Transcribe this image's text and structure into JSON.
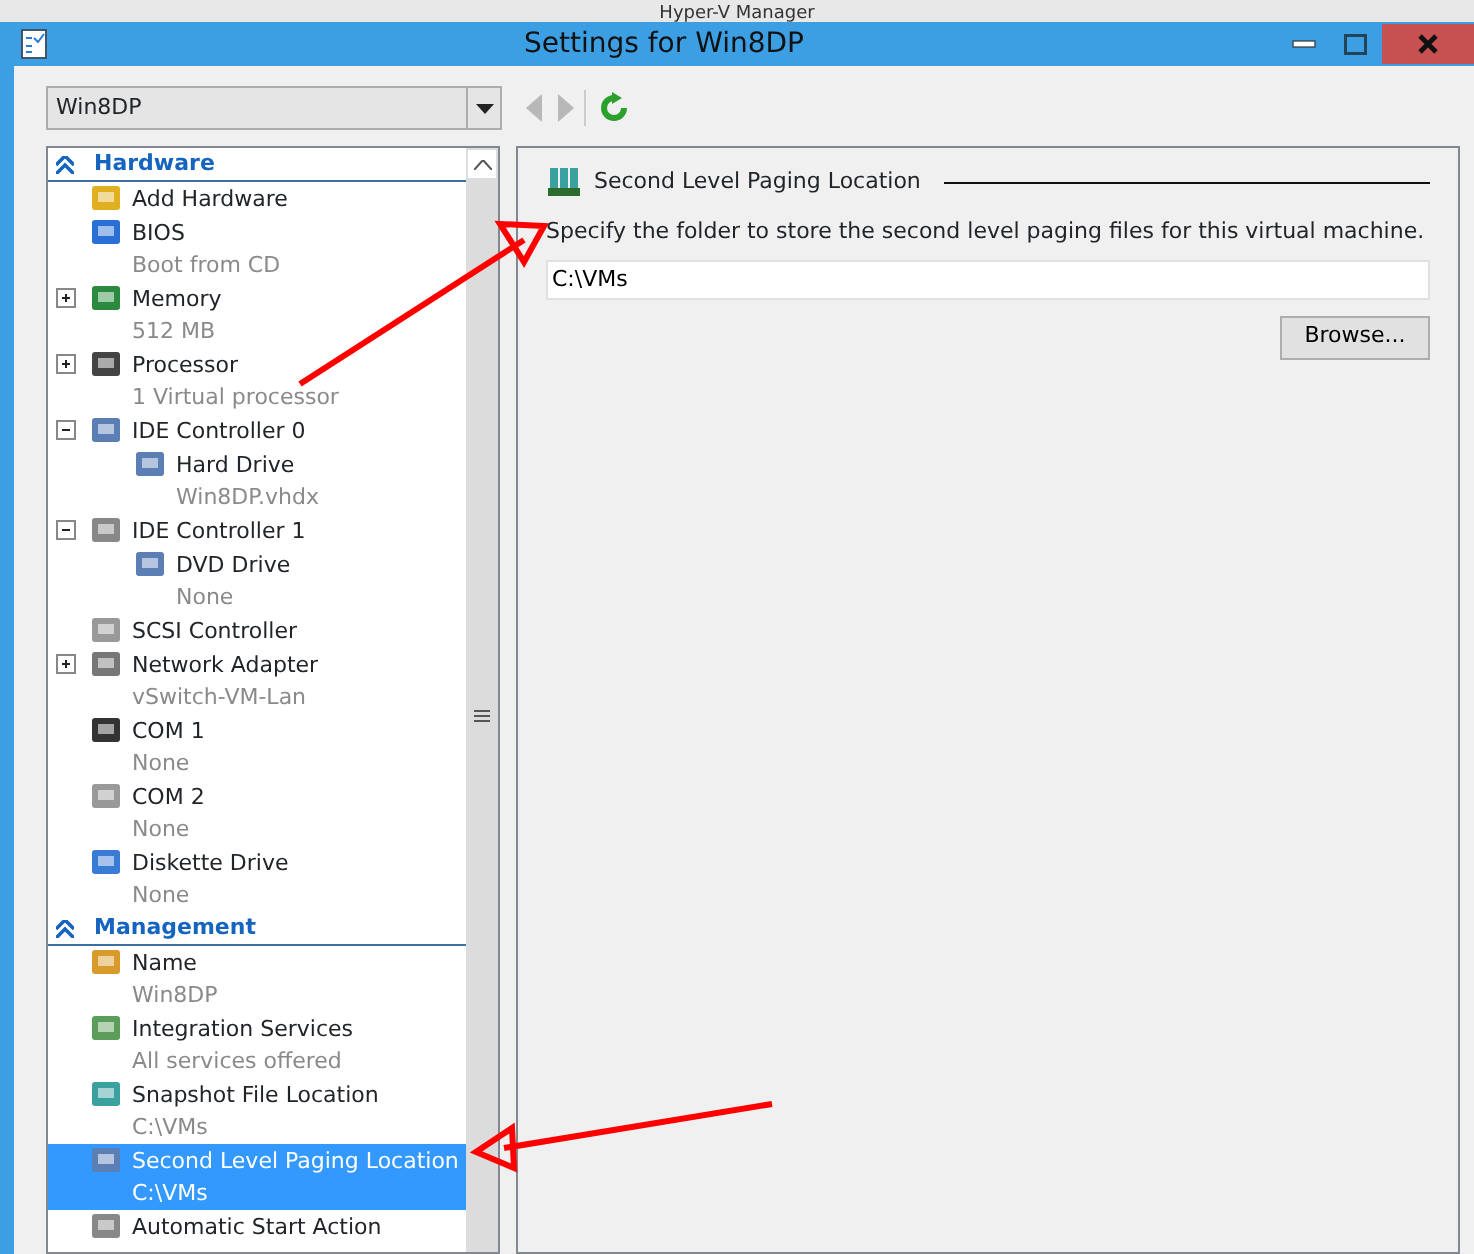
{
  "background_window": {
    "title": "Hyper-V Manager"
  },
  "window": {
    "title": "Settings for Win8DP"
  },
  "vm_selector": {
    "value": "Win8DP"
  },
  "toolbar": {
    "back": {
      "disabled": true
    },
    "forward": {
      "disabled": true
    }
  },
  "sidebar": {
    "sections": [
      {
        "title": "Hardware",
        "items": [
          {
            "label": "Add Hardware",
            "selected": false
          },
          {
            "label": "BIOS",
            "detail": "Boot from CD",
            "selected": false
          },
          {
            "label": "Memory",
            "detail": "512 MB",
            "expanded": false,
            "selected": false
          },
          {
            "label": "Processor",
            "detail": "1 Virtual processor",
            "expanded": false,
            "selected": false
          },
          {
            "label": "IDE Controller 0",
            "expanded": true,
            "selected": false,
            "children": [
              {
                "label": "Hard Drive",
                "detail": "Win8DP.vhdx",
                "selected": false
              }
            ]
          },
          {
            "label": "IDE Controller 1",
            "expanded": true,
            "selected": false,
            "children": [
              {
                "label": "DVD Drive",
                "detail": "None",
                "selected": false
              }
            ]
          },
          {
            "label": "SCSI Controller",
            "selected": false
          },
          {
            "label": "Network Adapter",
            "detail": "vSwitch-VM-Lan",
            "expanded": false,
            "selected": false
          },
          {
            "label": "COM 1",
            "detail": "None",
            "selected": false
          },
          {
            "label": "COM 2",
            "detail": "None",
            "selected": false
          },
          {
            "label": "Diskette Drive",
            "detail": "None",
            "selected": false
          }
        ]
      },
      {
        "title": "Management",
        "items": [
          {
            "label": "Name",
            "detail": "Win8DP",
            "selected": false
          },
          {
            "label": "Integration Services",
            "detail": "All services offered",
            "selected": false
          },
          {
            "label": "Snapshot File Location",
            "detail": "C:\\VMs",
            "selected": false
          },
          {
            "label": "Second Level Paging Location",
            "detail": "C:\\VMs",
            "selected": true
          },
          {
            "label": "Automatic Start Action",
            "selected": false
          }
        ]
      }
    ]
  },
  "panel": {
    "title": "Second Level Paging Location",
    "description": "Specify the folder to store the second level paging files for this virtual machine.",
    "path": {
      "value": "C:\\VMs"
    },
    "browse_button": "Browse..."
  },
  "annotations": [
    {
      "kind": "arrow"
    },
    {
      "kind": "arrow"
    }
  ]
}
